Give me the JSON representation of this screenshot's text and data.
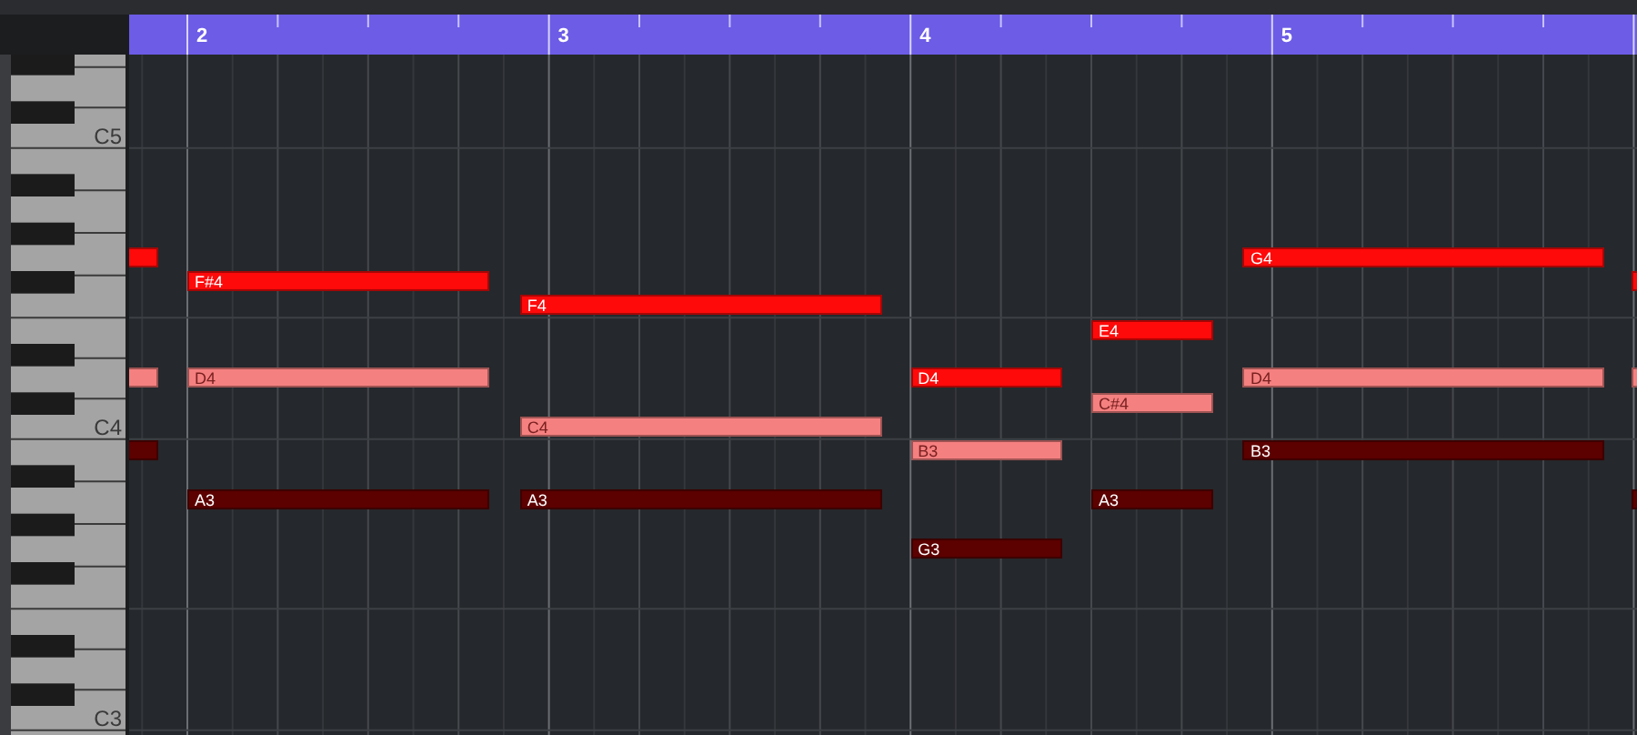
{
  "ruler": {
    "bars": [
      {
        "label": "2"
      },
      {
        "label": "3"
      },
      {
        "label": "4"
      },
      {
        "label": "5"
      }
    ]
  },
  "keyboard": {
    "octave_labels": [
      {
        "label": "C5"
      },
      {
        "label": "C4"
      },
      {
        "label": "C3"
      }
    ]
  },
  "notes": [
    {
      "color": "#ff0a0a"
    },
    {
      "color": "#f58080"
    },
    {
      "color": "#5c0000"
    },
    {
      "color": "#ff0a0a",
      "label": "F#4"
    },
    {
      "color": "#f58080",
      "label": "D4"
    },
    {
      "color": "#5c0000",
      "label": "A3"
    },
    {
      "color": "#ff0a0a",
      "label": "F4"
    },
    {
      "color": "#f58080",
      "label": "C4"
    },
    {
      "color": "#5c0000",
      "label": "A3"
    },
    {
      "color": "#ff0a0a",
      "label": "D4"
    },
    {
      "color": "#f58080",
      "label": "B3"
    },
    {
      "color": "#5c0000",
      "label": "G3"
    },
    {
      "color": "#ff0a0a",
      "label": "E4"
    },
    {
      "color": "#f58080",
      "label": "C#4"
    },
    {
      "color": "#5c0000",
      "label": "A3"
    },
    {
      "color": "#ff0a0a",
      "label": "G4"
    },
    {
      "color": "#f58080",
      "label": "D4"
    },
    {
      "color": "#5c0000",
      "label": "B3"
    },
    {
      "color": "#ff0a0a"
    },
    {
      "color": "#f58080"
    },
    {
      "color": "#5c0000"
    }
  ]
}
